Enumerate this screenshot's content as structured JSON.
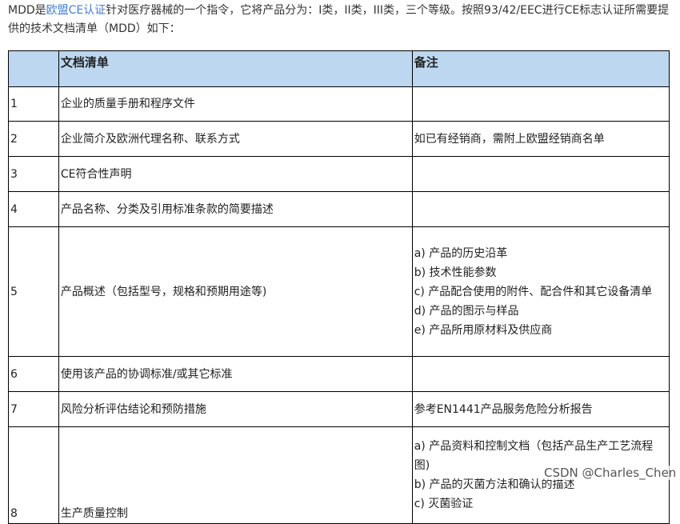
{
  "intro": {
    "p1_prefix": "MDD是",
    "p1_link": "欧盟CE认证",
    "p1_suffix": "针对医疗器械的一个指令，它将产品分为：I类，II类，III类，三个等级。按照93/42/EEC进行CE标志认证所需要提供的技术文档清单（MDD）如下："
  },
  "table": {
    "headers": [
      "",
      "文档清单",
      "备注"
    ],
    "rows": [
      {
        "num": "1",
        "name": "企业的质量手册和程序文件",
        "notes": []
      },
      {
        "num": "2",
        "name": "企业简介及欧洲代理名称、联系方式",
        "notes": [
          "如已有经销商，需附上欧盟经销商名单"
        ]
      },
      {
        "num": "3",
        "name": "CE符合性声明",
        "notes": []
      },
      {
        "num": "4",
        "name": "产品名称、分类及引用标准条款的简要描述",
        "notes": []
      },
      {
        "num": "5",
        "name": "产品概述（包括型号，规格和预期用途等)",
        "notes": [
          "a) 产品的历史沿革",
          "b) 技术性能参数",
          "c) 产品配合使用的附件、配合件和其它设备清单",
          "d) 产品的图示与样品",
          "e) 产品所用原材料及供应商"
        ]
      },
      {
        "num": "6",
        "name": "使用该产品的协调标准/或其它标准",
        "notes": []
      },
      {
        "num": "7",
        "name": "风险分析评估结论和预防措施",
        "notes": [
          "参考EN1441产品服务危险分析报告"
        ]
      },
      {
        "num": "8",
        "name": "生产质量控制",
        "notes": [
          "a) 产品资料和控制文档（包括产品生产工艺流程图)",
          "b) 产品的灭菌方法和确认的描述",
          "c) 灭菌验证"
        ]
      }
    ]
  },
  "signature": "CSDN @Charles_Chen"
}
